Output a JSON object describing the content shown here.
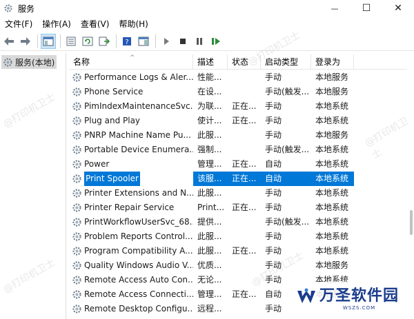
{
  "window": {
    "title": "服务",
    "minimize": "—",
    "maximize": "☐",
    "close": "✕"
  },
  "menu": [
    "文件(F)",
    "操作(A)",
    "查看(V)",
    "帮助(H)"
  ],
  "tree": {
    "root_label": "服务(本地)"
  },
  "columns": [
    "名称",
    "描述",
    "状态",
    "启动类型",
    "登录为"
  ],
  "services": [
    {
      "name": "Performance Logs & Aler...",
      "desc": "性能...",
      "status": "",
      "startup": "手动",
      "logon": "本地服务"
    },
    {
      "name": "Phone Service",
      "desc": "在设...",
      "status": "",
      "startup": "手动(触发...",
      "logon": "本地服务"
    },
    {
      "name": "PimIndexMaintenanceSvc...",
      "desc": "为联...",
      "status": "正在...",
      "startup": "手动",
      "logon": "本地系统"
    },
    {
      "name": "Plug and Play",
      "desc": "使计...",
      "status": "正在...",
      "startup": "手动",
      "logon": "本地系统"
    },
    {
      "name": "PNRP Machine Name Pu...",
      "desc": "此服...",
      "status": "",
      "startup": "手动",
      "logon": "本地服务"
    },
    {
      "name": "Portable Device Enumera...",
      "desc": "强制...",
      "status": "",
      "startup": "手动(触发...",
      "logon": "本地系统"
    },
    {
      "name": "Power",
      "desc": "管理...",
      "status": "正在...",
      "startup": "自动",
      "logon": "本地系统"
    },
    {
      "name": "Print Spooler",
      "desc": "该服...",
      "status": "正在...",
      "startup": "自动",
      "logon": "本地系统",
      "selected": true
    },
    {
      "name": "Printer Extensions and N...",
      "desc": "此服...",
      "status": "",
      "startup": "手动",
      "logon": "本地系统"
    },
    {
      "name": "Printer Repair Service",
      "desc": "Print...",
      "status": "正在...",
      "startup": "手动",
      "logon": "本地系统"
    },
    {
      "name": "PrintWorkflowUserSvc_68...",
      "desc": "提供...",
      "status": "",
      "startup": "手动(触发...",
      "logon": "本地系统"
    },
    {
      "name": "Problem Reports Control...",
      "desc": "此服...",
      "status": "",
      "startup": "手动",
      "logon": "本地系统"
    },
    {
      "name": "Program Compatibility A...",
      "desc": "此服...",
      "status": "正在...",
      "startup": "手动",
      "logon": "本地系统"
    },
    {
      "name": "Quality Windows Audio V...",
      "desc": "优质...",
      "status": "",
      "startup": "手动",
      "logon": "本地服务"
    },
    {
      "name": "Remote Access Auto Con...",
      "desc": "无论...",
      "status": "",
      "startup": "手动",
      "logon": "本地系统"
    },
    {
      "name": "Remote Access Connecti...",
      "desc": "管理...",
      "status": "正在...",
      "startup": "自动",
      "logon": "本地系统"
    },
    {
      "name": "Remote Desktop Configu...",
      "desc": "远程...",
      "status": "",
      "startup": "手动",
      "logon": ""
    }
  ],
  "watermark": "@打印机卫士",
  "logo": {
    "text": "万圣软件园",
    "sub": "WSZS.COM"
  },
  "colors": {
    "selection": "#0078d7",
    "icon_blue": "#1e6fd0",
    "logo_blue": "#1a3c8c"
  }
}
